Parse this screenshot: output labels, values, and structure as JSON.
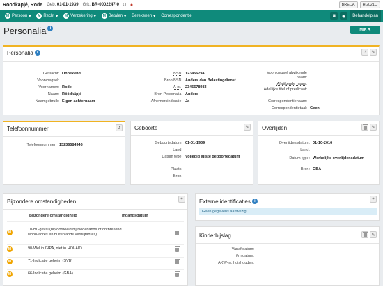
{
  "header": {
    "patient_name": "Röödkäpjé, Rode",
    "dob_label": "Geb.",
    "dob": "01-01-1939",
    "grk_label": "Grk.",
    "grk": "BR-0002247-0",
    "locations": [
      "BREDA",
      "HG021C"
    ]
  },
  "nav": {
    "items": [
      "Persoon",
      "Recht",
      "Verzekering",
      "Betalen",
      "Berekenen",
      "Correspondentie"
    ],
    "right_label": "Behandelplan"
  },
  "page": {
    "title": "Personalia",
    "mik_label": "MIK"
  },
  "personalia": {
    "title": "Personalia",
    "col1": [
      {
        "label": "Geslacht:",
        "value": "Onbekend"
      },
      {
        "label": "Voorvoegsel:",
        "value": ""
      },
      {
        "label": "Voornamen:",
        "value": "Rode"
      },
      {
        "label": "Naam:",
        "value": "Röödkäpjé"
      },
      {
        "label": "Naamgebruik:",
        "value": "Eigen achternaam"
      }
    ],
    "col2": [
      {
        "label": "BSN:",
        "value": "123456794"
      },
      {
        "label": "Bron BSN:",
        "value": "Anders dan Belastingdienst"
      },
      {
        "label": "A-nr.:",
        "value": "2345678983"
      },
      {
        "label": "Bron Personalia:",
        "value": "Anders"
      },
      {
        "label": "Afnemersindicatie:",
        "value": "Ja"
      }
    ],
    "col3": [
      {
        "label": "Voorvoegsel afwijkende naam:",
        "value": ""
      },
      {
        "label": "Afwijkende naam:",
        "value": ""
      },
      {
        "label": "Adellijke titel of predicaat:",
        "value": ""
      },
      {
        "label": "Correspondentienaam:",
        "value": ""
      },
      {
        "label": "Correspondentietaal:",
        "value": "Geen"
      }
    ]
  },
  "telefoon": {
    "title": "Telefoonnummer",
    "label": "Telefoonnummer:",
    "value": "13236584946"
  },
  "geboorte": {
    "title": "Geboorte",
    "rows": [
      {
        "label": "Geboortedatum:",
        "value": "01-01-1939"
      },
      {
        "label": "Land:",
        "value": ""
      },
      {
        "label": "Datum type:",
        "value": "Volledig juiste geboortedatum"
      },
      {
        "label": "Plaats:",
        "value": ""
      },
      {
        "label": "Bron:",
        "value": ""
      }
    ]
  },
  "overlijden": {
    "title": "Overlijden",
    "rows": [
      {
        "label": "Overlijdensdatum:",
        "value": "01-10-2016"
      },
      {
        "label": "Land:",
        "value": ""
      },
      {
        "label": "Datum type:",
        "value": "Werkelijke overlijdensdatum"
      },
      {
        "label": "Bron:",
        "value": "GBA"
      }
    ]
  },
  "bijzondere": {
    "title": "Bijzondere omstandigheden",
    "col_headers": [
      "Bijzondere omstandigheid",
      "Ingangsdatum"
    ],
    "rows": [
      {
        "badge": "M",
        "text": "10-BL-geval (bijvoorbeeld bij Nederlands of ontbrekend woon-adres en buitenlands verblijfadres)"
      },
      {
        "badge": "M",
        "text": "90-Wel in GIPA, niet in HOI-AIO"
      },
      {
        "badge": "M",
        "text": "71-Indicatie geheim (SVB)"
      },
      {
        "badge": "M",
        "text": "66-Indicatie geheim (GBA)"
      }
    ]
  },
  "externe": {
    "title": "Externe identificaties",
    "empty": "Geen gegevens aanwezig."
  },
  "kinderbijslag": {
    "title": "Kinderbijslag",
    "rows": [
      {
        "label": "Vanaf datum:",
        "value": ""
      },
      {
        "label": "t/m datum:",
        "value": ""
      },
      {
        "label": "AKW-nr. huishouden:",
        "value": ""
      }
    ]
  },
  "colors": {
    "nav": "#0f8a7b",
    "accent": "#f0b323",
    "badge": "#f0a500",
    "info": "#2f7fc1"
  }
}
